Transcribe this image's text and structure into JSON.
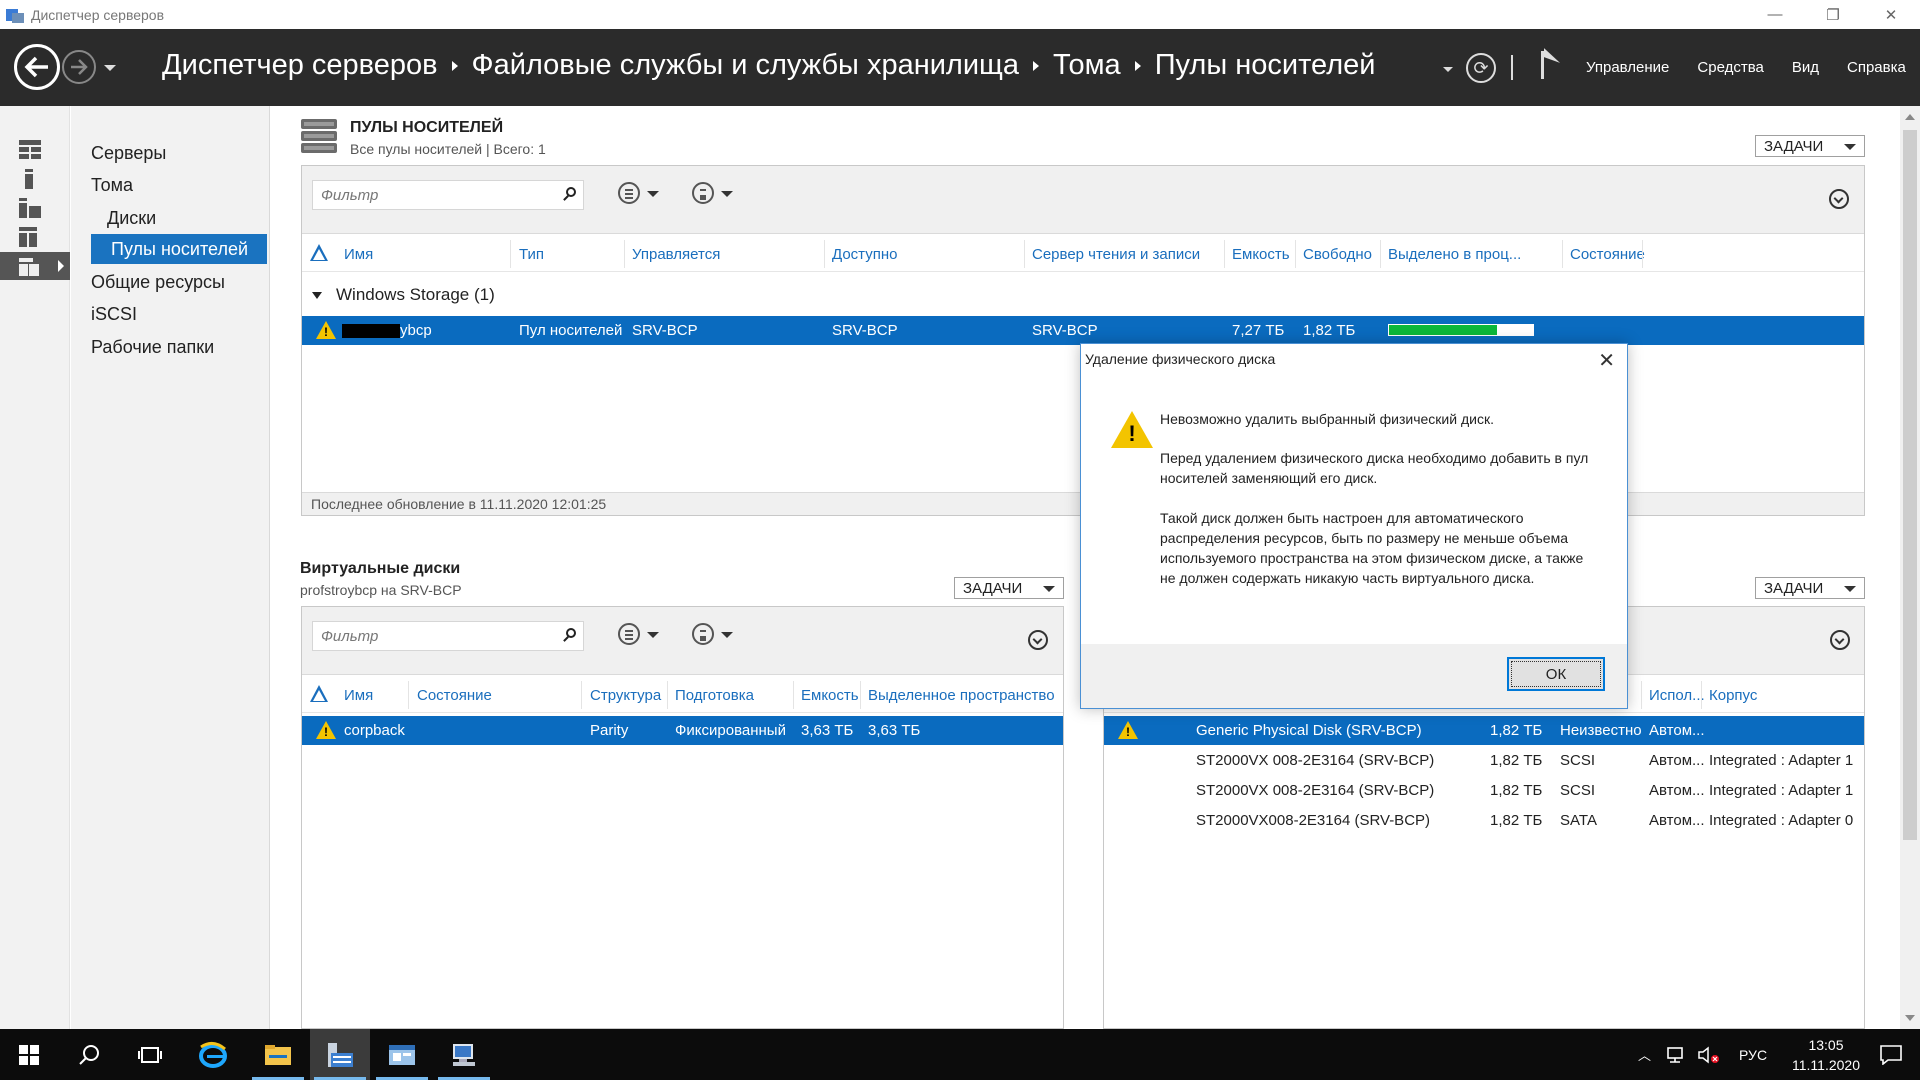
{
  "window": {
    "title": "Диспетчер серверов",
    "controls": {
      "minimize": "—",
      "restore": "❐",
      "close": "✕"
    }
  },
  "header": {
    "breadcrumb": [
      "Диспетчер серверов",
      "Файловые службы и службы хранилища",
      "Тома",
      "Пулы носителей"
    ],
    "menu": [
      "Управление",
      "Средства",
      "Вид",
      "Справка"
    ],
    "refresh_glyph": "⟳"
  },
  "nav": {
    "items": [
      {
        "label": "Серверы",
        "sub": false,
        "selected": false
      },
      {
        "label": "Тома",
        "sub": false,
        "selected": false
      },
      {
        "label": "Диски",
        "sub": true,
        "selected": false
      },
      {
        "label": "Пулы носителей",
        "sub": true,
        "selected": true
      },
      {
        "label": "Общие ресурсы",
        "sub": false,
        "selected": false
      },
      {
        "label": "iSCSI",
        "sub": false,
        "selected": false
      },
      {
        "label": "Рабочие папки",
        "sub": false,
        "selected": false
      }
    ]
  },
  "pools": {
    "title": "ПУЛЫ НОСИТЕЛЕЙ",
    "subtitle": "Все пулы носителей | Всего: 1",
    "tasks": "ЗАДАЧИ",
    "filter_placeholder": "Фильтр",
    "columns": [
      "Имя",
      "Тип",
      "Управляется",
      "Доступно",
      "Сервер чтения и записи",
      "Емкость",
      "Свободно",
      "Выделено в проц...",
      "Состояние"
    ],
    "group": "Windows Storage (1)",
    "row": {
      "name_suffix": "ybcp",
      "type": "Пул носителей",
      "managed_by": "SRV-BCP",
      "available_to": "SRV-BCP",
      "rw_server": "SRV-BCP",
      "capacity": "7,27 ТБ",
      "free": "1,82 ТБ",
      "allocated_fraction": 0.75,
      "status": ""
    },
    "last_update": "Последнее обновление в 11.11.2020 12:01:25"
  },
  "vdisks": {
    "title": "Виртуальные диски",
    "subtitle": "profstroybcp на SRV-BCP",
    "tasks": "ЗАДАЧИ",
    "filter_placeholder": "Фильтр",
    "columns": [
      "Имя",
      "Состояние",
      "Структура",
      "Подготовка",
      "Емкость",
      "Выделенное пространство"
    ],
    "rows": [
      {
        "name": "corpback",
        "state": "",
        "layout": "Parity",
        "provisioning": "Фиксированный",
        "capacity": "3,63 ТБ",
        "allocated": "3,63 ТБ"
      }
    ]
  },
  "pdisks": {
    "tasks": "ЗАДАЧИ",
    "columns": [
      "Испол...",
      "Корпус"
    ],
    "rows": [
      {
        "name": "Generic Physical Disk (SRV-BCP)",
        "capacity": "1,82 ТБ",
        "bus": "Неизвестно",
        "usage": "Автом...",
        "chassis": "",
        "warn": true
      },
      {
        "name": "ST2000VX 008-2E3164 (SRV-BCP)",
        "capacity": "1,82 ТБ",
        "bus": "SCSI",
        "usage": "Автом...",
        "chassis": "Integrated : Adapter 1",
        "warn": false
      },
      {
        "name": "ST2000VX 008-2E3164 (SRV-BCP)",
        "capacity": "1,82 ТБ",
        "bus": "SCSI",
        "usage": "Автом...",
        "chassis": "Integrated : Adapter 1",
        "warn": false
      },
      {
        "name": "ST2000VX008-2E3164 (SRV-BCP)",
        "capacity": "1,82 ТБ",
        "bus": "SATA",
        "usage": "Автом...",
        "chassis": "Integrated : Adapter 0",
        "warn": false
      }
    ]
  },
  "dialog": {
    "title": "Удаление физического диска",
    "line1": "Невозможно удалить выбранный физический диск.",
    "para2": "Перед удалением физического диска необходимо добавить в пул носителей заменяющий его диск.",
    "para3": "Такой диск должен быть настроен для автоматического распределения ресурсов, быть по размеру не меньше объема используемого пространства на этом физическом диске, а также не должен содержать никакую часть виртуального диска.",
    "ok": "ОК"
  },
  "taskbar": {
    "lang": "РУС",
    "time": "13:05",
    "date": "11.11.2020"
  },
  "colors": {
    "header_bg": "#2b2b2b",
    "selection": "#0a6bbf",
    "nav_selected": "#1a73c0",
    "warning": "#f3c400",
    "progress": "#0cb83a"
  }
}
